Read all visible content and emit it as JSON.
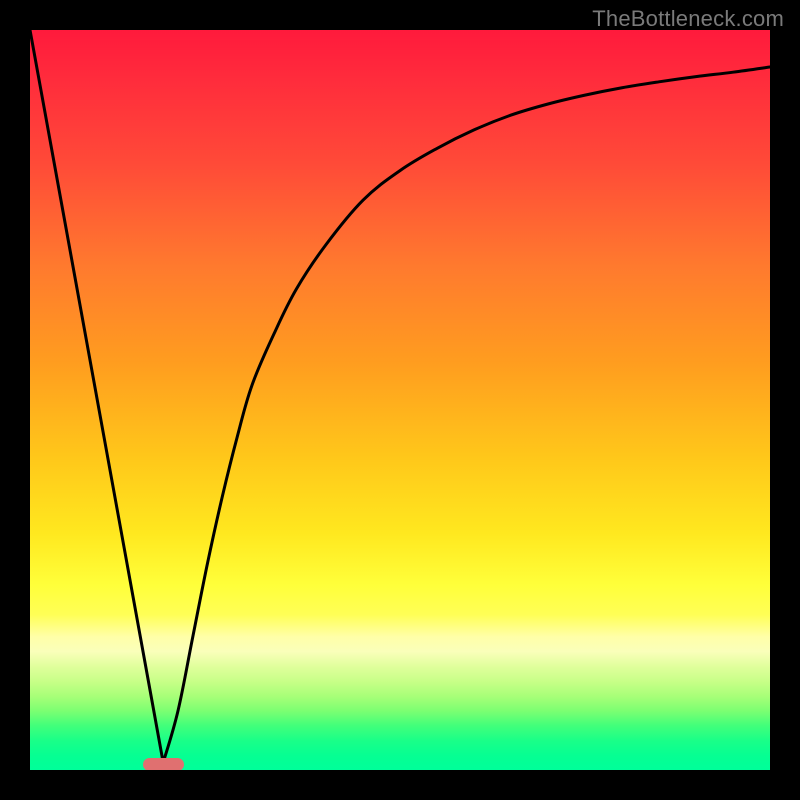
{
  "header": {
    "watermark": "TheBottleneck.com"
  },
  "colors": {
    "frame": "#000000",
    "curve": "#000000",
    "marker": "#e07070",
    "gradient_top": "#ff1a3c",
    "gradient_mid": "#ffe81f",
    "gradient_bottom": "#00ff9a"
  },
  "chart_data": {
    "type": "line",
    "title": "",
    "xlabel": "",
    "ylabel": "",
    "xlim": [
      0,
      100
    ],
    "ylim": [
      0,
      100
    ],
    "grid": false,
    "series": [
      {
        "name": "left-leg",
        "x": [
          0,
          2,
          4,
          6,
          8,
          10,
          12,
          14,
          16,
          18
        ],
        "values": [
          100,
          89,
          78,
          67,
          56,
          45,
          34,
          23,
          12,
          1
        ]
      },
      {
        "name": "right-curve",
        "x": [
          18,
          20,
          22,
          24,
          26,
          28,
          30,
          33,
          36,
          40,
          45,
          50,
          55,
          60,
          65,
          70,
          75,
          80,
          85,
          90,
          95,
          100
        ],
        "values": [
          1,
          8,
          18,
          28,
          37,
          45,
          52,
          59,
          65,
          71,
          77,
          81,
          84,
          86.5,
          88.5,
          90,
          91.2,
          92.2,
          93,
          93.7,
          94.3,
          95
        ]
      }
    ],
    "annotations": [
      {
        "name": "optimum-marker",
        "shape": "pill",
        "x": 18,
        "y": 0.7,
        "width_pct": 5.5,
        "height_pct": 1.8
      }
    ],
    "background": "vertical-gradient-red-yellow-green"
  }
}
